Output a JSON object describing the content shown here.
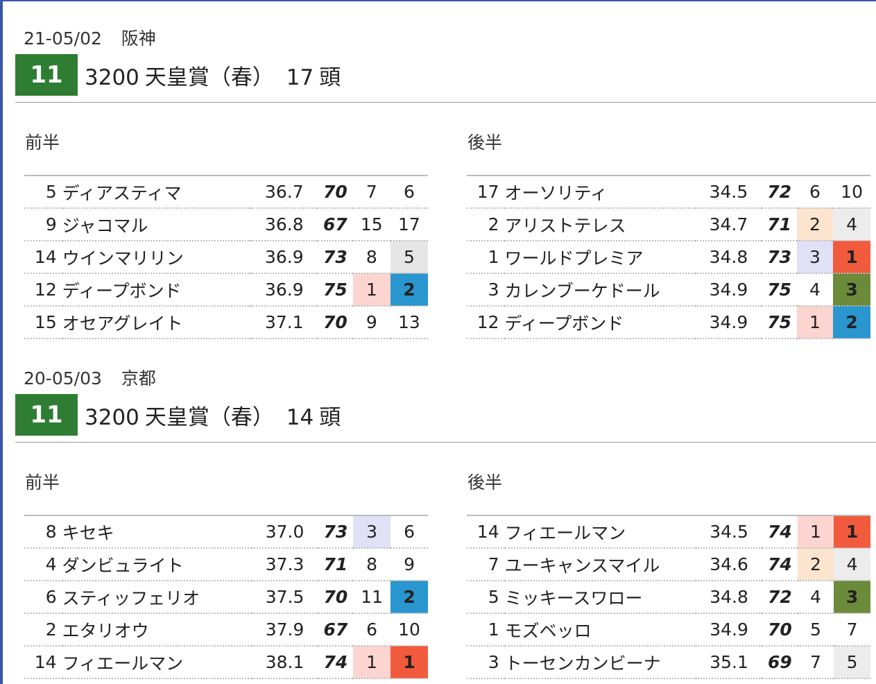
{
  "races": [
    {
      "date": "21-05/02",
      "venue": "阪神",
      "race_no": "11",
      "distance": "3200",
      "race_name": "天皇賞（春）",
      "heads_count": "17",
      "heads_unit": "頭",
      "halves": [
        {
          "label": "前半",
          "rows": [
            {
              "num": "5",
              "name": "ディアスティマ",
              "time": "36.7",
              "speed": "70",
              "speed_color": "black",
              "r1": "7",
              "r1_style": "",
              "r2": "6",
              "r2_style": ""
            },
            {
              "num": "9",
              "name": "ジャコマル",
              "time": "36.8",
              "speed": "67",
              "speed_color": "black",
              "r1": "15",
              "r1_style": "",
              "r2": "17",
              "r2_style": ""
            },
            {
              "num": "14",
              "name": "ウインマリリン",
              "time": "36.9",
              "speed": "73",
              "speed_color": "blue",
              "r1": "8",
              "r1_style": "",
              "r2": "5",
              "r2_style": "pl5"
            },
            {
              "num": "12",
              "name": "ディープボンド",
              "time": "36.9",
              "speed": "75",
              "speed_color": "red",
              "r1": "1",
              "r1_style": "p1",
              "r2": "2",
              "r2_style": "f2"
            },
            {
              "num": "15",
              "name": "オセアグレイト",
              "time": "37.1",
              "speed": "70",
              "speed_color": "black",
              "r1": "9",
              "r1_style": "",
              "r2": "13",
              "r2_style": ""
            }
          ]
        },
        {
          "label": "後半",
          "rows": [
            {
              "num": "17",
              "name": "オーソリティ",
              "time": "34.5",
              "speed": "72",
              "speed_color": "green",
              "r1": "6",
              "r1_style": "",
              "r2": "10",
              "r2_style": ""
            },
            {
              "num": "2",
              "name": "アリストテレス",
              "time": "34.7",
              "speed": "71",
              "speed_color": "red",
              "r1": "2",
              "r1_style": "p2",
              "r2": "4",
              "r2_style": "f4"
            },
            {
              "num": "1",
              "name": "ワールドプレミア",
              "time": "34.8",
              "speed": "73",
              "speed_color": "green",
              "r1": "3",
              "r1_style": "p3",
              "r2": "1",
              "r2_style": "f1"
            },
            {
              "num": "3",
              "name": "カレンブーケドール",
              "time": "34.9",
              "speed": "75",
              "speed_color": "blue",
              "r1": "4",
              "r1_style": "",
              "r2": "3",
              "r2_style": "f3"
            },
            {
              "num": "12",
              "name": "ディープボンド",
              "time": "34.9",
              "speed": "75",
              "speed_color": "red",
              "r1": "1",
              "r1_style": "p1",
              "r2": "2",
              "r2_style": "f2"
            }
          ]
        }
      ]
    },
    {
      "date": "20-05/03",
      "venue": "京都",
      "race_no": "11",
      "distance": "3200",
      "race_name": "天皇賞（春）",
      "heads_count": "14",
      "heads_unit": "頭",
      "halves": [
        {
          "label": "前半",
          "rows": [
            {
              "num": "8",
              "name": "キセキ",
              "time": "37.0",
              "speed": "73",
              "speed_color": "blue",
              "r1": "3",
              "r1_style": "p3",
              "r2": "6",
              "r2_style": ""
            },
            {
              "num": "4",
              "name": "ダンビュライト",
              "time": "37.3",
              "speed": "71",
              "speed_color": "green",
              "r1": "8",
              "r1_style": "",
              "r2": "9",
              "r2_style": ""
            },
            {
              "num": "6",
              "name": "スティッフェリオ",
              "time": "37.5",
              "speed": "70",
              "speed_color": "black",
              "r1": "11",
              "r1_style": "",
              "r2": "2",
              "r2_style": "f2"
            },
            {
              "num": "2",
              "name": "エタリオウ",
              "time": "37.9",
              "speed": "67",
              "speed_color": "black",
              "r1": "6",
              "r1_style": "",
              "r2": "10",
              "r2_style": ""
            },
            {
              "num": "14",
              "name": "フィエールマン",
              "time": "38.1",
              "speed": "74",
              "speed_color": "red",
              "r1": "1",
              "r1_style": "p1",
              "r2": "1",
              "r2_style": "f1"
            }
          ]
        },
        {
          "label": "後半",
          "rows": [
            {
              "num": "14",
              "name": "フィエールマン",
              "time": "34.5",
              "speed": "74",
              "speed_color": "red",
              "r1": "1",
              "r1_style": "p1",
              "r2": "1",
              "r2_style": "f1"
            },
            {
              "num": "7",
              "name": "ユーキャンスマイル",
              "time": "34.6",
              "speed": "74",
              "speed_color": "blue",
              "r1": "2",
              "r1_style": "p2",
              "r2": "4",
              "r2_style": "f4"
            },
            {
              "num": "5",
              "name": "ミッキースワロー",
              "time": "34.8",
              "speed": "72",
              "speed_color": "green",
              "r1": "4",
              "r1_style": "",
              "r2": "3",
              "r2_style": "f3"
            },
            {
              "num": "1",
              "name": "モズベッロ",
              "time": "34.9",
              "speed": "70",
              "speed_color": "red",
              "r1": "5",
              "r1_style": "",
              "r2": "7",
              "r2_style": ""
            },
            {
              "num": "3",
              "name": "トーセンカンビーナ",
              "time": "35.1",
              "speed": "69",
              "speed_color": "black",
              "r1": "7",
              "r1_style": "",
              "r2": "5",
              "r2_style": "f5"
            }
          ]
        }
      ]
    }
  ]
}
